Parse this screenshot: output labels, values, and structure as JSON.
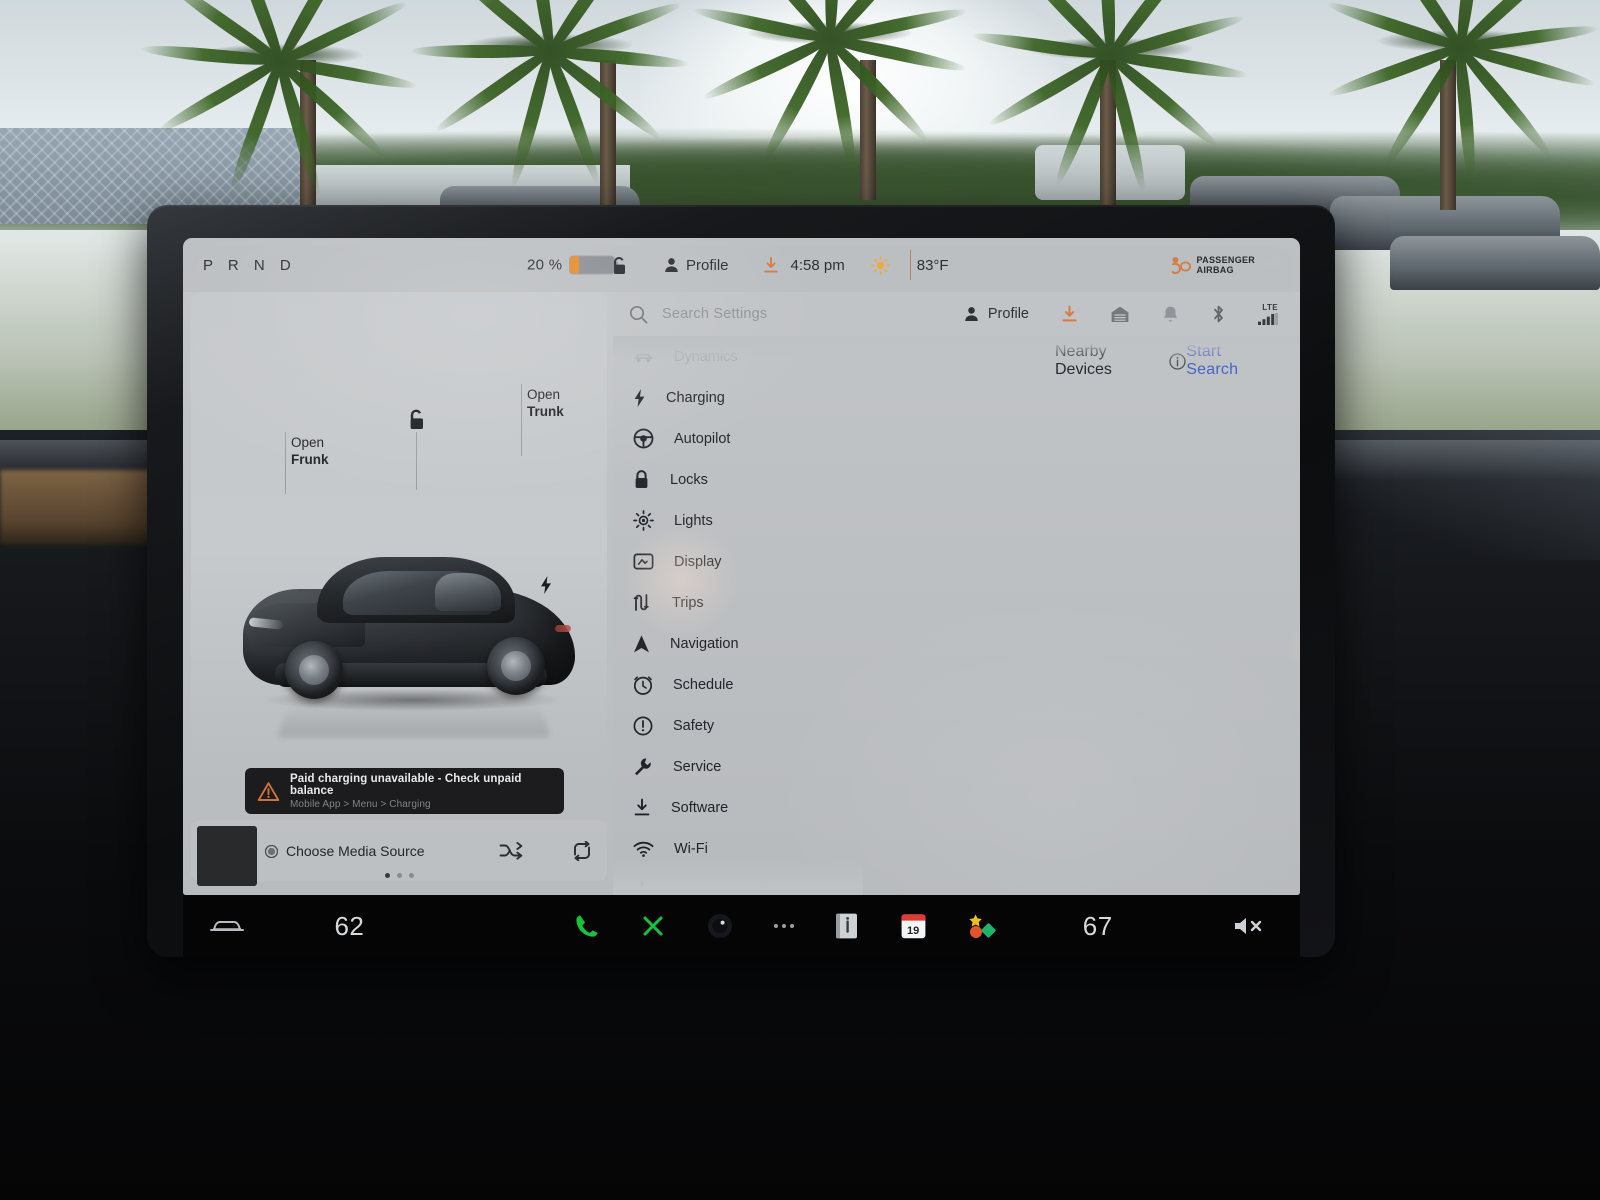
{
  "status_bar": {
    "gear_indicator": "P R N D",
    "battery_percent": "20 %",
    "battery_level": 20,
    "lock_icon": "unlocked-padlock-icon",
    "profile_label": "Profile",
    "download_icon": "software-download-icon",
    "time": "4:58 pm",
    "weather_icon": "sun-icon",
    "temperature": "83°F",
    "airbag_line1": "PASSENGER",
    "airbag_line2": "AIRBAG",
    "airbag_state": "OFF"
  },
  "car_card": {
    "open_frunk_line1": "Open",
    "open_frunk_line2": "Frunk",
    "open_trunk_line1": "Open",
    "open_trunk_line2": "Trunk",
    "lock_icon": "unlocked-padlock-icon",
    "charge_port_icon": "charge-port-bolt-icon"
  },
  "alert": {
    "title": "Paid charging unavailable - Check unpaid balance",
    "subtitle": "Mobile App > Menu > Charging",
    "icon": "warning-triangle-icon",
    "icon_color": "#d4763a"
  },
  "media_player": {
    "source_label": "Choose Media Source",
    "source_icon": "media-source-dot-icon",
    "shuffle_icon": "shuffle-icon",
    "repeat_icon": "repeat-icon",
    "controls": [
      {
        "name": "previous-track",
        "icon": "skip-back-icon",
        "enabled": true
      },
      {
        "name": "play",
        "icon": "play-icon",
        "enabled": false
      },
      {
        "name": "next-track",
        "icon": "skip-forward-icon",
        "enabled": true
      },
      {
        "name": "add-to-favorites",
        "icon": "plus-circle-icon",
        "enabled": true
      },
      {
        "name": "equalizer",
        "icon": "sliders-icon",
        "enabled": true
      },
      {
        "name": "search-media",
        "icon": "search-icon",
        "enabled": true
      }
    ],
    "page_dots": 3,
    "page_active": 0
  },
  "settings": {
    "search_placeholder": "Search Settings",
    "search_icon": "search-icon",
    "toolbar": {
      "profile_label": "Profile",
      "profile_icon": "person-icon",
      "download_icon": "software-download-icon",
      "garage_icon": "garage-door-icon",
      "notification_icon": "bell-icon",
      "bluetooth_icon": "bluetooth-icon",
      "signal_label": "LTE",
      "signal_icon": "cellular-signal-icon"
    },
    "menu_items": [
      {
        "label": "Dynamics",
        "icon": "suspension-icon",
        "state": "dim"
      },
      {
        "label": "Charging",
        "icon": "bolt-icon",
        "state": "normal"
      },
      {
        "label": "Autopilot",
        "icon": "steering-wheel-icon",
        "state": "normal"
      },
      {
        "label": "Locks",
        "icon": "lock-icon",
        "state": "normal"
      },
      {
        "label": "Lights",
        "icon": "lightbulb-icon",
        "state": "normal"
      },
      {
        "label": "Display",
        "icon": "display-icon",
        "state": "normal"
      },
      {
        "label": "Trips",
        "icon": "trips-icon",
        "state": "normal"
      },
      {
        "label": "Navigation",
        "icon": "navigation-arrow-icon",
        "state": "normal"
      },
      {
        "label": "Schedule",
        "icon": "clock-icon",
        "state": "normal"
      },
      {
        "label": "Safety",
        "icon": "exclamation-circle-icon",
        "state": "normal"
      },
      {
        "label": "Service",
        "icon": "wrench-icon",
        "state": "normal"
      },
      {
        "label": "Software",
        "icon": "software-download-icon",
        "state": "normal"
      },
      {
        "label": "Wi-Fi",
        "icon": "wifi-icon",
        "state": "normal"
      }
    ],
    "panel": {
      "title": "Nearby Devices",
      "info_icon": "info-circle-icon",
      "action_label": "Start Search",
      "action_color": "#3f5ec2"
    }
  },
  "taskbar": {
    "car_icon": "car-icon",
    "driver_temp": "62",
    "passenger_temp": "67",
    "phone_icon": "phone-icon",
    "phone_color": "#19c23a",
    "bluetooth_x_icon": "bluetooth-disconnected-icon",
    "bluetooth_x_color": "#19c23a",
    "camera_icon": "camera-icon",
    "more_icon": "more-dots-icon",
    "info_app_icon": "owners-manual-icon",
    "calendar_icon": "calendar-icon",
    "calendar_day": "19",
    "toybox_icon": "toybox-icon",
    "volume_icon": "volume-muted-icon"
  }
}
